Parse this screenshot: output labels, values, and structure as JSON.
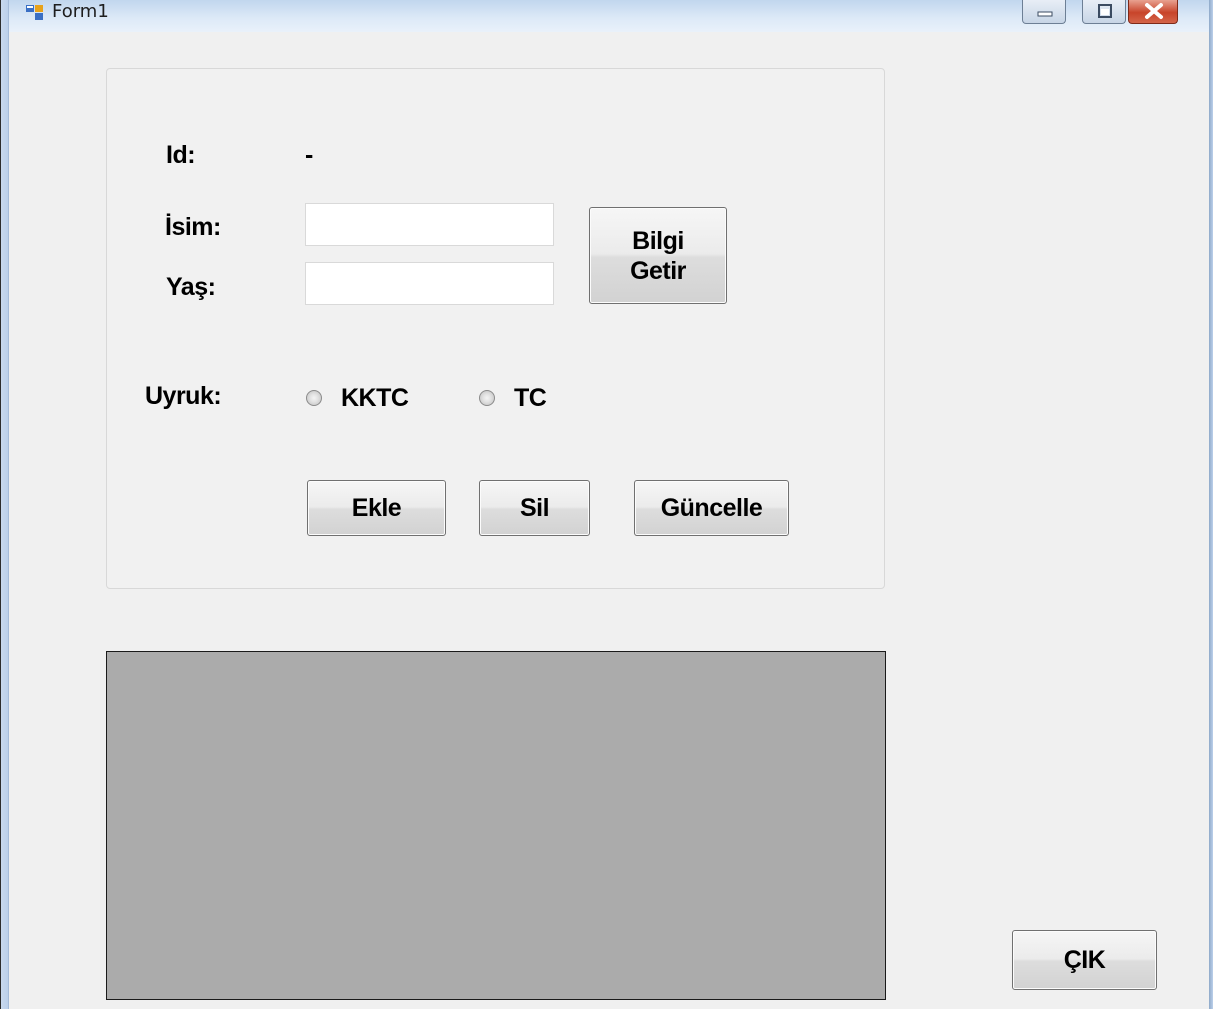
{
  "window": {
    "title": "Form1"
  },
  "form": {
    "id_label": "Id:",
    "id_value": "-",
    "name_label": "İsim:",
    "name_value": "",
    "age_label": "Yaş:",
    "age_value": "",
    "nationality_label": "Uyruk:",
    "nationality_options": [
      "KKTC",
      "TC"
    ],
    "fetch_button_line1": "Bilgi",
    "fetch_button_line2": "Getir",
    "add_button": "Ekle",
    "delete_button": "Sil",
    "update_button": "Güncelle"
  },
  "exit_button": "ÇIK",
  "colors": {
    "form_background": "#f0f0f0",
    "grid_background": "#ababab",
    "close_button": "#c8442a"
  }
}
